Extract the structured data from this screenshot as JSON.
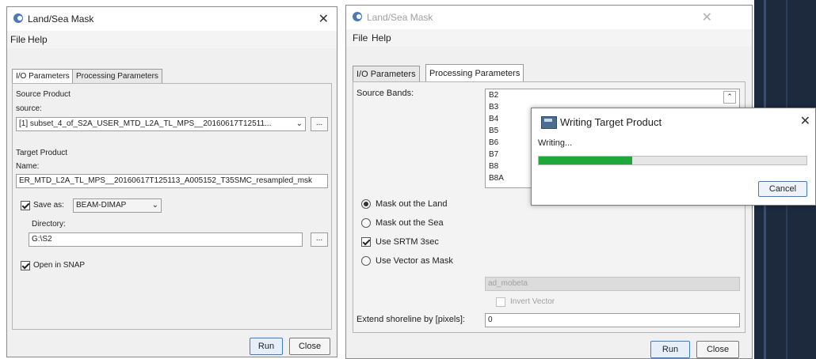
{
  "left_window": {
    "title": "Land/Sea Mask",
    "menu": [
      "File",
      "Help"
    ],
    "tabs": [
      "I/O Parameters",
      "Processing Parameters"
    ],
    "source_product": {
      "section_label": "Source Product",
      "source_label": "source:",
      "source_value": "[1] subset_4_of_S2A_USER_MTD_L2A_TL_MPS__20160617T12511...",
      "browse_label": "..."
    },
    "target_product": {
      "section_label": "Target Product",
      "name_label": "Name:",
      "name_value": "ER_MTD_L2A_TL_MPS__20160617T125113_A005152_T35SMC_resampled_msk",
      "save_as_label": "Save as:",
      "save_as_checked": true,
      "format_value": "BEAM-DIMAP",
      "directory_label": "Directory:",
      "directory_value": "G:\\S2",
      "browse_label": "...",
      "open_in_snap_label": "Open in SNAP",
      "open_in_snap_checked": true
    },
    "buttons": {
      "run": "Run",
      "close": "Close"
    }
  },
  "right_window": {
    "title": "Land/Sea Mask",
    "menu": [
      "File",
      "Help"
    ],
    "tabs": [
      "I/O Parameters",
      "Processing Parameters"
    ],
    "source_bands_label": "Source Bands:",
    "bands": [
      "B2",
      "B3",
      "B4",
      "B5",
      "B6",
      "B7",
      "B8",
      "B8A"
    ],
    "options": {
      "mask_land": "Mask out the Land",
      "mask_sea": "Mask out the Sea",
      "use_srtm": "Use SRTM 3sec",
      "use_vector": "Use Vector as Mask",
      "selected": "mask_land",
      "use_srtm_checked": true
    },
    "vector_value": "ad_mobeta",
    "invert_vector_label": "Invert Vector",
    "extend_shoreline_label": "Extend shoreline by [pixels]:",
    "extend_shoreline_value": "0",
    "buttons": {
      "run": "Run",
      "close": "Close"
    }
  },
  "progress_dialog": {
    "title": "Writing Target Product",
    "status": "Writing...",
    "progress": 0.35,
    "cancel_label": "Cancel"
  },
  "colors": {
    "progress_fill": "#1fa83a",
    "dark_background": "#1d2a3e"
  }
}
